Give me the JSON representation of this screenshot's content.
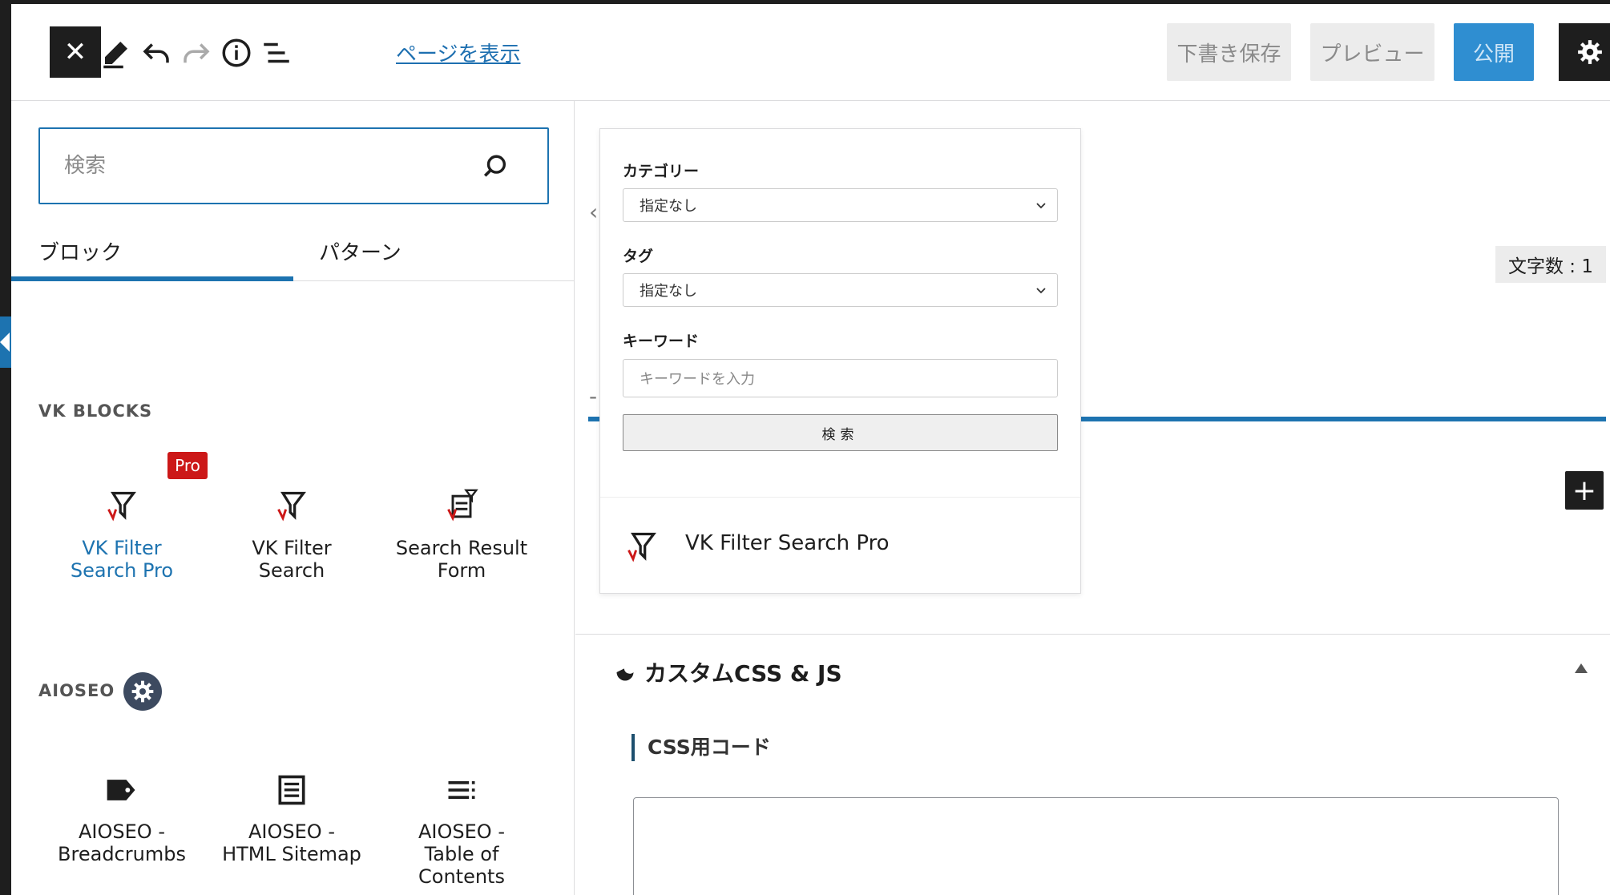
{
  "header": {
    "close_label": "✕",
    "view_page_link": "ページを表示",
    "save_draft_label": "下書き保存",
    "preview_label": "プレビュー",
    "publish_label": "公開"
  },
  "inserter": {
    "search_placeholder": "検索",
    "tabs": [
      "ブロック",
      "パターン"
    ],
    "sections": [
      {
        "title": "VK BLOCKS",
        "items": [
          {
            "line1": "VK Filter",
            "line2": "Search Pro",
            "badge": "Pro"
          },
          {
            "line1": "VK Filter",
            "line2": "Search"
          },
          {
            "line1": "Search Result",
            "line2": "Form"
          }
        ]
      },
      {
        "title": "AIOSEO",
        "items": [
          {
            "line1": "AIOSEO -",
            "line2": "Breadcrumbs"
          },
          {
            "line1": "AIOSEO -",
            "line2": "HTML Sitemap"
          },
          {
            "line1": "AIOSEO -",
            "line2": "Table of",
            "line3": "Contents"
          }
        ]
      }
    ]
  },
  "canvas": {
    "word_count": "文字数 : 1"
  },
  "preview_card": {
    "category_label": "カテゴリー",
    "category_value": "指定なし",
    "tag_label": "タグ",
    "tag_value": "指定なし",
    "keyword_label": "キーワード",
    "keyword_placeholder": "キーワードを入力",
    "search_button": "検索",
    "footer_title": "VK Filter Search Pro"
  },
  "meta_box": {
    "title": "カスタムCSS & JS",
    "css_label": "CSS用コード"
  },
  "colors": {
    "accent": "#1d73b0",
    "dark": "#1e1e1e",
    "pro_badge": "#cc1818"
  }
}
